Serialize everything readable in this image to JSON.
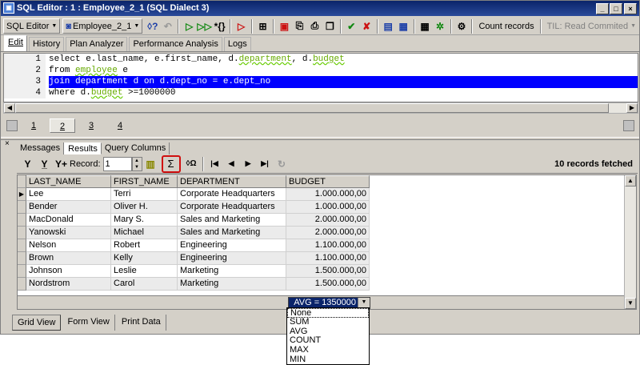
{
  "window": {
    "title": "SQL Editor : 1 : Employee_2_1 (SQL Dialect 3)"
  },
  "toolbar": {
    "sql_editor_label": "SQL Editor",
    "database_label": "Employee_2_1",
    "count_records_label": "Count records",
    "transaction_label": "TIL: Read Commited"
  },
  "tabs": [
    "Edit",
    "History",
    "Plan Analyzer",
    "Performance Analysis",
    "Logs"
  ],
  "editor": {
    "lines": [
      {
        "num": "1",
        "segments": [
          {
            "t": "select e.last_name, e.first_name, d."
          },
          {
            "t": "department",
            "u": true
          },
          {
            "t": ", d."
          },
          {
            "t": "budget",
            "u": true
          }
        ]
      },
      {
        "num": "2",
        "segments": [
          {
            "t": "from "
          },
          {
            "t": "employee",
            "u": true
          },
          {
            "t": " e"
          }
        ]
      },
      {
        "num": "3",
        "selected": true,
        "segments": [
          {
            "t": "join department d on d.dept_no = e.dept_no"
          }
        ]
      },
      {
        "num": "4",
        "segments": [
          {
            "t": "where d."
          },
          {
            "t": "budget",
            "u": true
          },
          {
            "t": " >=1000000"
          }
        ]
      }
    ]
  },
  "query_tabs": [
    "1",
    "2",
    "3",
    "4"
  ],
  "result_tabs": [
    "Messages",
    "Results",
    "Query Columns"
  ],
  "results_toolbar": {
    "record_label": "Record:",
    "record_value": "1",
    "fetched_text": "10 records fetched"
  },
  "grid": {
    "columns": [
      "LAST_NAME",
      "FIRST_NAME",
      "DEPARTMENT",
      "BUDGET"
    ],
    "rows": [
      [
        "Lee",
        "Terri",
        "Corporate Headquarters",
        "1.000.000,00"
      ],
      [
        "Bender",
        "Oliver H.",
        "Corporate Headquarters",
        "1.000.000,00"
      ],
      [
        "MacDonald",
        "Mary S.",
        "Sales and Marketing",
        "2.000.000,00"
      ],
      [
        "Yanowski",
        "Michael",
        "Sales and Marketing",
        "2.000.000,00"
      ],
      [
        "Nelson",
        "Robert",
        "Engineering",
        "1.100.000,00"
      ],
      [
        "Brown",
        "Kelly",
        "Engineering",
        "1.100.000,00"
      ],
      [
        "Johnson",
        "Leslie",
        "Marketing",
        "1.500.000,00"
      ],
      [
        "Nordstrom",
        "Carol",
        "Marketing",
        "1.500.000,00"
      ]
    ],
    "aggregate_value": "AVG = 1350000"
  },
  "aggregate_options": [
    "None",
    "SUM",
    "AVG",
    "COUNT",
    "MAX",
    "MIN"
  ],
  "bottom_tabs": [
    "Grid View",
    "Form View",
    "Print Data"
  ]
}
